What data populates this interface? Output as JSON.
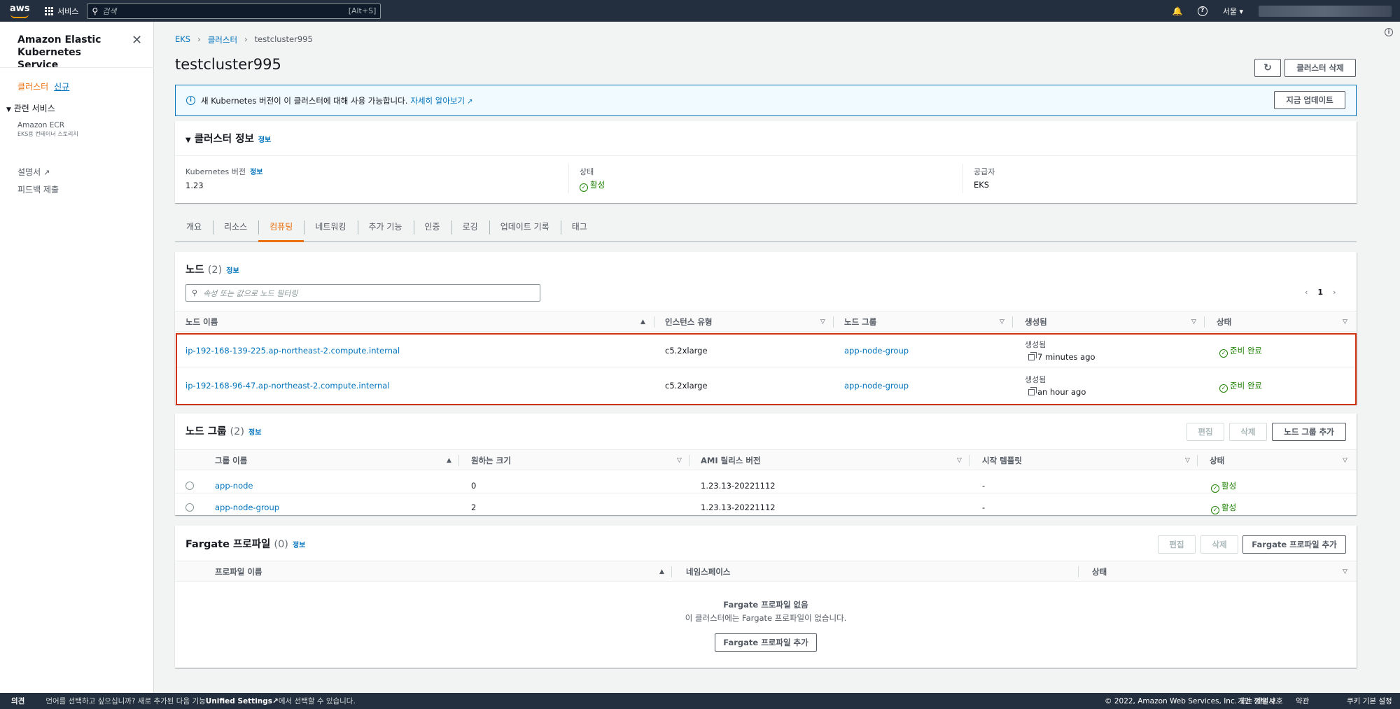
{
  "topnav": {
    "logo": "aws",
    "services_label": "서비스",
    "search_placeholder": "검색",
    "search_shortcut": "[Alt+S]",
    "region": "서울 ▾"
  },
  "sidenav": {
    "title": "Amazon Elastic Kubernetes Service",
    "clusters": "클러스터",
    "new_badge": "신규",
    "related": "관련 서비스",
    "ecr": "Amazon ECR",
    "ecr_sub": "EKS용 컨테이너 스토리지",
    "docs": "설명서",
    "feedback": "피드백 제출"
  },
  "breadcrumb": [
    "EKS",
    "클러스터",
    "testcluster995"
  ],
  "page": {
    "title": "testcluster995",
    "delete_button": "클러스터 삭제"
  },
  "banner": {
    "text": "새 Kubernetes 버전이 이 클러스터에 대해 사용 가능합니다.",
    "link": "자세히 알아보기",
    "button": "지금 업데이트"
  },
  "cluster_info": {
    "heading": "클러스터 정보",
    "info": "정보",
    "k8s_label": "Kubernetes 버전",
    "k8s_info": "정보",
    "k8s_value": "1.23",
    "status_label": "상태",
    "status_value": "활성",
    "provider_label": "공급자",
    "provider_value": "EKS"
  },
  "tabs": [
    "개요",
    "리소스",
    "컴퓨팅",
    "네트워킹",
    "추가 기능",
    "인증",
    "로깅",
    "업데이트 기록",
    "태그"
  ],
  "nodes": {
    "heading": "노드",
    "count": "(2)",
    "info": "정보",
    "filter_placeholder": "속성 또는 값으로 노드 필터링",
    "page": "1",
    "columns": [
      "노드 이름",
      "인스턴스 유형",
      "노드 그룹",
      "생성됨",
      "상태"
    ],
    "rows": [
      {
        "name": "ip-192-168-139-225.ap-northeast-2.compute.internal",
        "instance": "c5.2xlarge",
        "group": "app-node-group",
        "created_label": "생성됨",
        "created": "7 minutes ago",
        "status": "준비 완료"
      },
      {
        "name": "ip-192-168-96-47.ap-northeast-2.compute.internal",
        "instance": "c5.2xlarge",
        "group": "app-node-group",
        "created_label": "생성됨",
        "created": "an hour ago",
        "status": "준비 완료"
      }
    ]
  },
  "nodegroups": {
    "heading": "노드 그룹",
    "count": "(2)",
    "info": "정보",
    "edit": "편집",
    "delete": "삭제",
    "add": "노드 그룹 추가",
    "columns": [
      "그룹 이름",
      "원하는 크기",
      "AMI 릴리스 버전",
      "시작 템플릿",
      "상태"
    ],
    "rows": [
      {
        "name": "app-node",
        "size": "0",
        "ami": "1.23.13-20221112",
        "template": "-",
        "status": "활성"
      },
      {
        "name": "app-node-group",
        "size": "2",
        "ami": "1.23.13-20221112",
        "template": "-",
        "status": "활성"
      }
    ]
  },
  "fargate": {
    "heading": "Fargate 프로파일",
    "count": "(0)",
    "info": "정보",
    "edit": "편집",
    "delete": "삭제",
    "add": "Fargate 프로파일 추가",
    "columns": [
      "프로파일 이름",
      "네임스페이스",
      "상태"
    ],
    "empty_title": "Fargate 프로파일 없음",
    "empty_desc": "이 클러스터에는 Fargate 프로파일이 없습니다.",
    "empty_button": "Fargate 프로파일 추가"
  },
  "footer": {
    "feedback": "의견",
    "lang_before": "언어를 선택하고 싶으십니까? 새로 추가된 다음 기능",
    "unified": "Unified Settings",
    "lang_after": "에서 선택할 수 있습니다.",
    "copyright": "© 2022, Amazon Web Services, Inc. 또는 계열사.",
    "privacy": "개인 정보 보호",
    "terms": "약관",
    "cookies": "쿠키 기본 설정"
  },
  "colors": {
    "nav_bg": "#232f3e",
    "link": "#0073bb",
    "accent": "#ec7211",
    "success": "#1d8102",
    "highlight": "#d13212"
  }
}
